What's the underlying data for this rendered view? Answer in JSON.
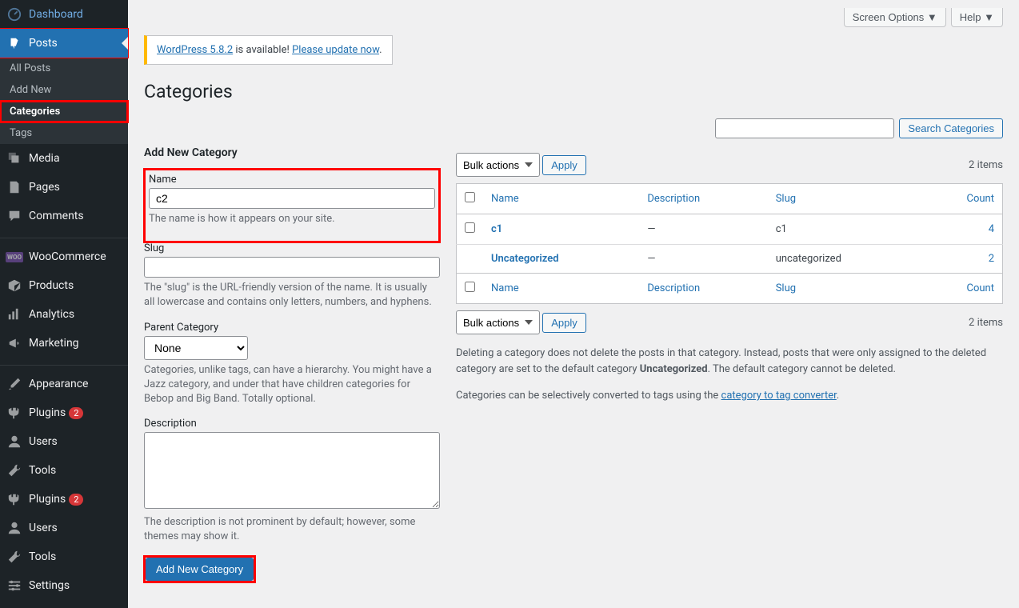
{
  "topbar": {
    "screen_options": "Screen Options ▼",
    "help": "Help ▼"
  },
  "sidebar": {
    "dashboard": "Dashboard",
    "posts": "Posts",
    "posts_sub": {
      "all": "All Posts",
      "add": "Add New",
      "categories": "Categories",
      "tags": "Tags"
    },
    "media": "Media",
    "pages": "Pages",
    "comments": "Comments",
    "woocommerce": "WooCommerce",
    "products": "Products",
    "analytics": "Analytics",
    "marketing": "Marketing",
    "appearance": "Appearance",
    "plugins": "Plugins",
    "plugins_badge": "2",
    "users": "Users",
    "tools": "Tools",
    "plugins2": "Plugins",
    "plugins2_badge": "2",
    "users2": "Users",
    "tools2": "Tools",
    "settings": "Settings"
  },
  "notice": {
    "link1": "WordPress 5.8.2",
    "mid": " is available! ",
    "link2": "Please update now",
    "end": "."
  },
  "page": {
    "title": "Categories"
  },
  "form": {
    "heading": "Add New Category",
    "name_label": "Name",
    "name_value": "c2",
    "name_desc": "The name is how it appears on your site.",
    "slug_label": "Slug",
    "slug_desc": "The \"slug\" is the URL-friendly version of the name. It is usually all lowercase and contains only letters, numbers, and hyphens.",
    "parent_label": "Parent Category",
    "parent_value": "None",
    "parent_desc": "Categories, unlike tags, can have a hierarchy. You might have a Jazz category, and under that have children categories for Bebop and Big Band. Totally optional.",
    "desc_label": "Description",
    "desc_desc": "The description is not prominent by default; however, some themes may show it.",
    "submit": "Add New Category"
  },
  "list": {
    "search_btn": "Search Categories",
    "bulk": "Bulk actions",
    "apply": "Apply",
    "items": "2 items",
    "cols": {
      "name": "Name",
      "description": "Description",
      "slug": "Slug",
      "count": "Count"
    },
    "rows": [
      {
        "name": "c1",
        "description": "—",
        "slug": "c1",
        "count": "4"
      },
      {
        "name": "Uncategorized",
        "description": "—",
        "slug": "uncategorized",
        "count": "2"
      }
    ],
    "footer1a": "Deleting a category does not delete the posts in that category. Instead, posts that were only assigned to the deleted category are set to the default category ",
    "footer1b": "Uncategorized",
    "footer1c": ". The default category cannot be deleted.",
    "footer2a": "Categories can be selectively converted to tags using the ",
    "footer2link": "category to tag converter",
    "footer2b": "."
  }
}
